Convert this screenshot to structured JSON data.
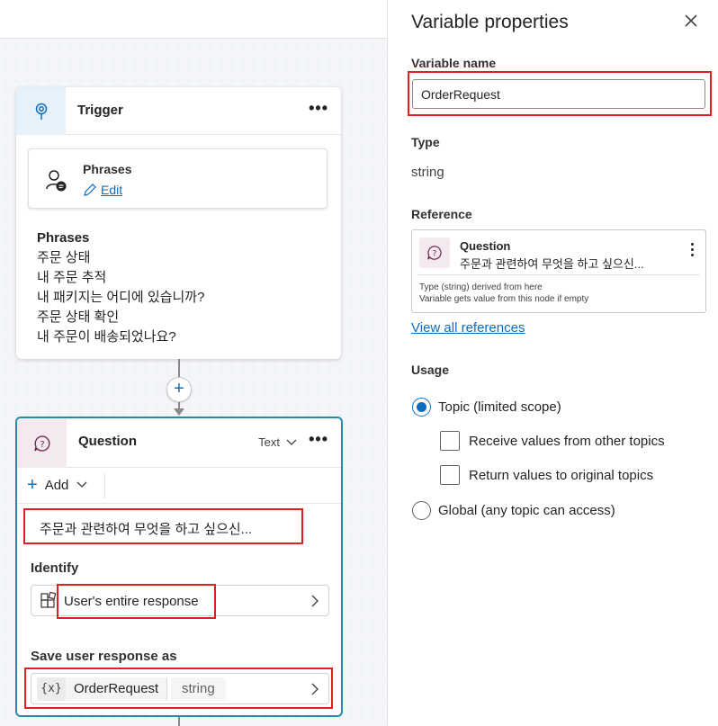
{
  "trigger": {
    "title": "Trigger",
    "more_label": "•••",
    "card_title": "Phrases",
    "edit_label": "Edit",
    "phrases_heading": "Phrases",
    "phrases": [
      "주문 상태",
      "내 주문 추적",
      "내 패키지는 어디에 있습니까?",
      "주문 상태 확인",
      "내 주문이 배송되었나요?"
    ]
  },
  "add_node": {
    "label": "+"
  },
  "question": {
    "title": "Question",
    "type_label": "Text",
    "more_label": "•••",
    "add_label": "Add",
    "message": "주문과 관련하여 무엇을 하고 싶으신...",
    "identify_label": "Identify",
    "identify_value": "User's entire response",
    "save_label": "Save user response as",
    "var_icon": "{x}",
    "var_name": "OrderRequest",
    "var_type": "string"
  },
  "panel": {
    "title": "Variable properties",
    "close_icon": "✕",
    "variable_name_label": "Variable name",
    "variable_name_value": "OrderRequest",
    "type_label": "Type",
    "type_value": "string",
    "reference_label": "Reference",
    "reference": {
      "title": "Question",
      "subtitle": "주문과 관련하여 무엇을 하고 싶으신...",
      "note1": "Type (string) derived from here",
      "note2": "Variable gets value from this node if empty"
    },
    "view_all_refs": "View all references",
    "usage_label": "Usage",
    "usage_topic": "Topic (limited scope)",
    "receive_values": "Receive values from other topics",
    "return_values": "Return values to original topics",
    "usage_global": "Global (any topic can access)",
    "selected_usage": "topic"
  },
  "colors": {
    "accent": "#0f6cbd",
    "highlight": "#e02020",
    "question_border": "#2b88a8"
  }
}
